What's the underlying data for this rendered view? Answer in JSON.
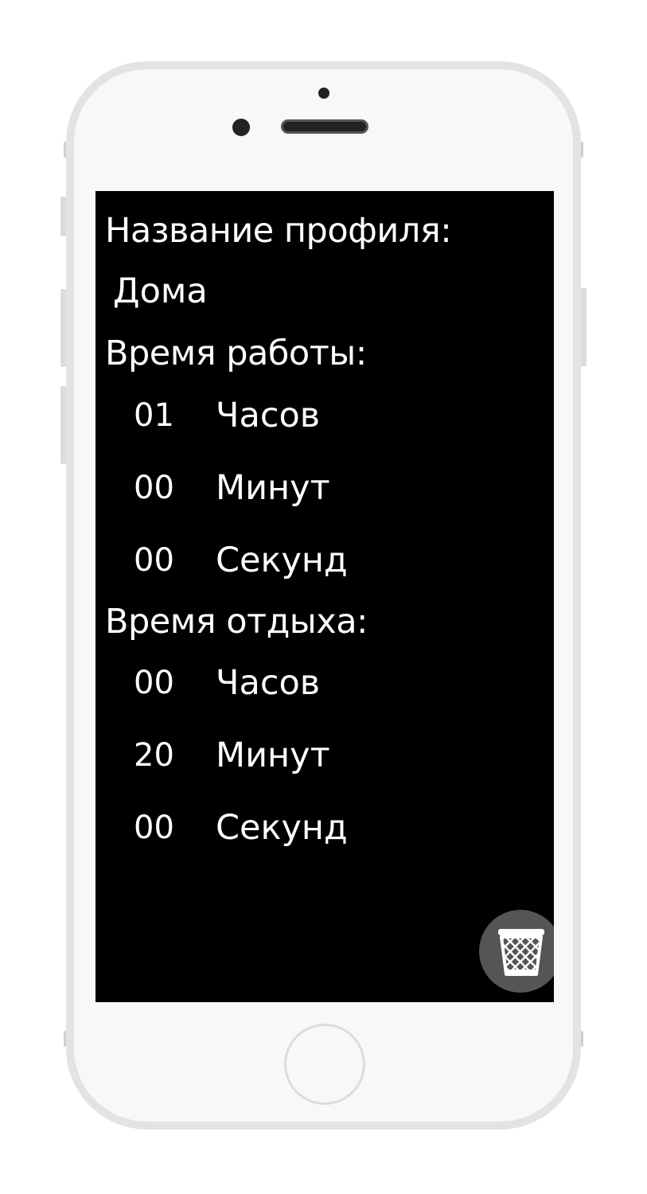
{
  "profile": {
    "name_label": "Название профиля:",
    "name_value": "Дома"
  },
  "work": {
    "label": "Время работы:",
    "rows": [
      {
        "value": "01",
        "unit": "Часов"
      },
      {
        "value": "00",
        "unit": "Минут"
      },
      {
        "value": "00",
        "unit": "Секунд"
      }
    ]
  },
  "rest": {
    "label": "Время отдыха:",
    "rows": [
      {
        "value": "00",
        "unit": "Часов"
      },
      {
        "value": "20",
        "unit": "Минут"
      },
      {
        "value": "00",
        "unit": "Секунд"
      }
    ]
  },
  "icons": {
    "delete": "trash-icon"
  },
  "colors": {
    "screen_bg": "#000000",
    "text": "#ffffff",
    "fab_bg": "#555555"
  }
}
